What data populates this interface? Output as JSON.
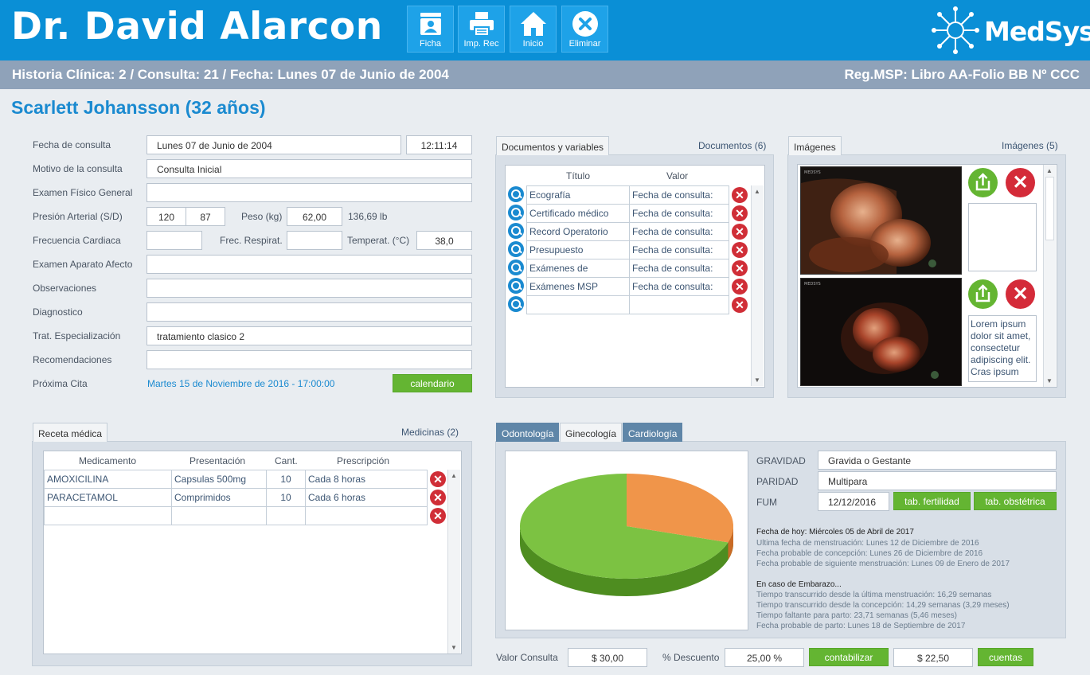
{
  "header": {
    "doctor_name": "Dr. David Alarcon",
    "buttons": {
      "ficha": "Ficha",
      "imp_rec": "Imp. Rec",
      "inicio": "Inicio",
      "eliminar": "Eliminar"
    },
    "logo": "MedSys"
  },
  "subheader": {
    "left": "Historia Clínica: 2 / Consulta: 21 / Fecha: Lunes 07 de Junio de 2004",
    "right": "Reg.MSP: Libro AA-Folio BB Nº CCC"
  },
  "patient": {
    "title": "Scarlett Johansson (32 años)"
  },
  "form": {
    "fecha_consulta": {
      "label": "Fecha de consulta",
      "value": "Lunes 07 de Junio de 2004",
      "time": "12:11:14"
    },
    "motivo": {
      "label": "Motivo de la consulta",
      "value": "Consulta Inicial"
    },
    "examen_fisico": {
      "label": "Examen Físico General",
      "value": ""
    },
    "presion": {
      "label": "Presión Arterial (S/D)",
      "systolic": "120",
      "diastolic": "87"
    },
    "peso": {
      "label": "Peso (kg)",
      "value": "62,00",
      "lb": "136,69 lb"
    },
    "frecuencia": {
      "label": "Frecuencia Cardiaca",
      "value": ""
    },
    "frec_resp": {
      "label": "Frec. Respirat.",
      "value": ""
    },
    "temperat": {
      "label": "Temperat. (°C)",
      "value": "38,0"
    },
    "examen_aparato": {
      "label": "Examen Aparato Afecto",
      "value": ""
    },
    "observaciones": {
      "label": "Observaciones",
      "value": ""
    },
    "diagnostico": {
      "label": "Diagnostico",
      "value": ""
    },
    "trat": {
      "label": "Trat. Especialización",
      "value": "tratamiento clasico 2"
    },
    "recomendaciones": {
      "label": "Recomendaciones",
      "value": ""
    },
    "proxima": {
      "label": "Próxima Cita",
      "value": "Martes 15 de Noviembre de 2016 - 17:00:00",
      "button": "calendario"
    }
  },
  "documentos": {
    "tab": "Documentos y variables",
    "count": "Documentos (6)",
    "headers": [
      "Título",
      "Valor"
    ],
    "rows": [
      {
        "titulo": "Ecografía",
        "valor": "Fecha de consulta:"
      },
      {
        "titulo": "Certificado médico",
        "valor": "Fecha de consulta:"
      },
      {
        "titulo": "Record Operatorio",
        "valor": "Fecha de consulta:"
      },
      {
        "titulo": "Presupuesto",
        "valor": "Fecha de consulta:"
      },
      {
        "titulo": "Exámenes de",
        "valor": "Fecha de consulta:"
      },
      {
        "titulo": "Exámenes MSP",
        "valor": "Fecha de consulta:"
      },
      {
        "titulo": "",
        "valor": ""
      }
    ]
  },
  "imagenes": {
    "tab": "Imágenes",
    "count": "Imágenes (5)",
    "items": [
      {
        "note": ""
      },
      {
        "note": "Lorem ipsum dolor sit amet, consectetur adipiscing elit. Cras ipsum"
      }
    ]
  },
  "receta": {
    "tab": "Receta médica",
    "count": "Medicinas (2)",
    "headers": [
      "Medicamento",
      "Presentación",
      "Cant.",
      "Prescripción"
    ],
    "rows": [
      {
        "med": "AMOXICILINA",
        "pres": "Capsulas 500mg",
        "cant": "10",
        "presc": "Cada 8 horas"
      },
      {
        "med": "PARACETAMOL",
        "pres": "Comprimidos",
        "cant": "10",
        "presc": "Cada 6 horas"
      },
      {
        "med": "",
        "pres": "",
        "cant": "",
        "presc": ""
      }
    ]
  },
  "especialidad": {
    "tabs": [
      "Odontología",
      "Ginecología",
      "Cardiología"
    ],
    "active_tab": "Ginecología",
    "gravidad": {
      "label": "GRAVIDAD",
      "value": "Gravida o Gestante"
    },
    "paridad": {
      "label": "PARIDAD",
      "value": "Multipara"
    },
    "fum": {
      "label": "FUM",
      "value": "12/12/2016",
      "btn1": "tab. fertilidad",
      "btn2": "tab. obstétrica"
    },
    "info1": [
      "Fecha de hoy: Miércoles 05 de Abril de 2017",
      "Ultima fecha de menstruación: Lunes 12 de Diciembre de 2016",
      "Fecha probable de concepción: Lunes 26 de Diciembre de 2016",
      "Fecha probable de siguiente menstruación: Lunes 09 de Enero de 2017"
    ],
    "info2": [
      "En caso de Embarazo...",
      "Tiempo transcurrido desde la última menstruación: 16,29 semanas",
      "Tiempo transcurrido desde la concepción: 14,29 semanas (3,29 meses)",
      "Tiempo faltante para parto: 23,71 semanas (5,46 meses)",
      "Fecha probable de parto: Lunes 18 de Septiembre de 2017"
    ],
    "pie_fraction_orange": 0.3,
    "colors": {
      "green": "#7cc242",
      "orange": "#f0954a"
    }
  },
  "billing": {
    "valor_label": "Valor Consulta",
    "valor": "$ 30,00",
    "descuento_label": "% Descuento",
    "descuento": "25,00 %",
    "contabilizar": "contabilizar",
    "total": "$ 22,50",
    "cuentas": "cuentas"
  }
}
